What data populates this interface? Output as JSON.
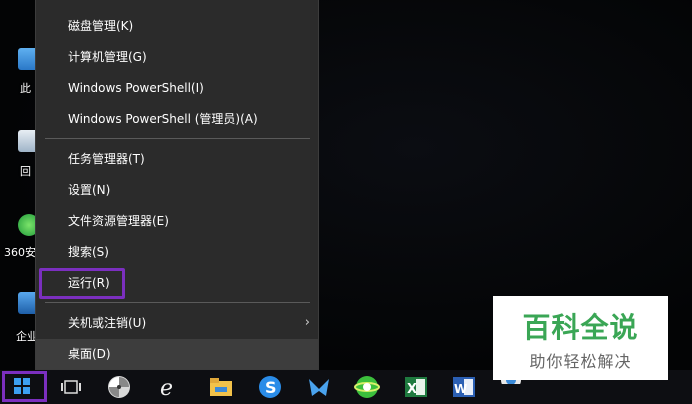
{
  "desktop": {
    "icons": [
      {
        "label": "此"
      },
      {
        "label": "回"
      },
      {
        "label": "360安"
      },
      {
        "label": "企业"
      }
    ]
  },
  "menu": {
    "items": [
      {
        "label": "磁盘管理(K)"
      },
      {
        "label": "计算机管理(G)"
      },
      {
        "label": "Windows PowerShell(I)"
      },
      {
        "label": "Windows PowerShell (管理员)(A)"
      },
      {
        "label": "任务管理器(T)"
      },
      {
        "label": "设置(N)"
      },
      {
        "label": "文件资源管理器(E)"
      },
      {
        "label": "搜索(S)"
      },
      {
        "label": "运行(R)"
      },
      {
        "label": "关机或注销(U)"
      },
      {
        "label": "桌面(D)"
      }
    ],
    "submenu_chevron": "›",
    "highlighted_item": "运行(R)"
  },
  "taskbar": {
    "start_icon": "windows-logo-icon",
    "icons": [
      "task-view-icon",
      "pinwheel-icon",
      "ie-icon",
      "file-explorer-icon",
      "sogou-browser-icon",
      "feishu-icon",
      "360-browser-icon",
      "excel-icon",
      "word-icon",
      "media-icon"
    ]
  },
  "watermark": {
    "title": "百科全说",
    "subtitle": "助你轻松解决"
  },
  "colors": {
    "menu_bg": "#2b2b2b",
    "highlight": "#7b2fbf",
    "watermark_green": "#3aa655"
  }
}
